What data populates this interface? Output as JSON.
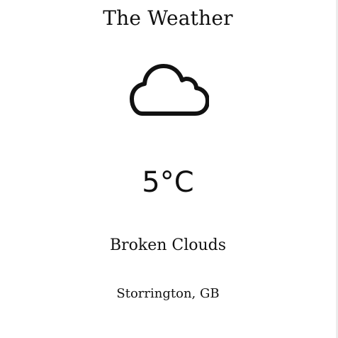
{
  "app": {
    "title": "The Weather"
  },
  "weather": {
    "icon": "cloud-icon",
    "temperature": "5°C",
    "condition": "Broken Clouds",
    "location": "Storrington, GB"
  },
  "colors": {
    "text": "#111111",
    "background": "#ffffff",
    "edge": "#ececec"
  }
}
